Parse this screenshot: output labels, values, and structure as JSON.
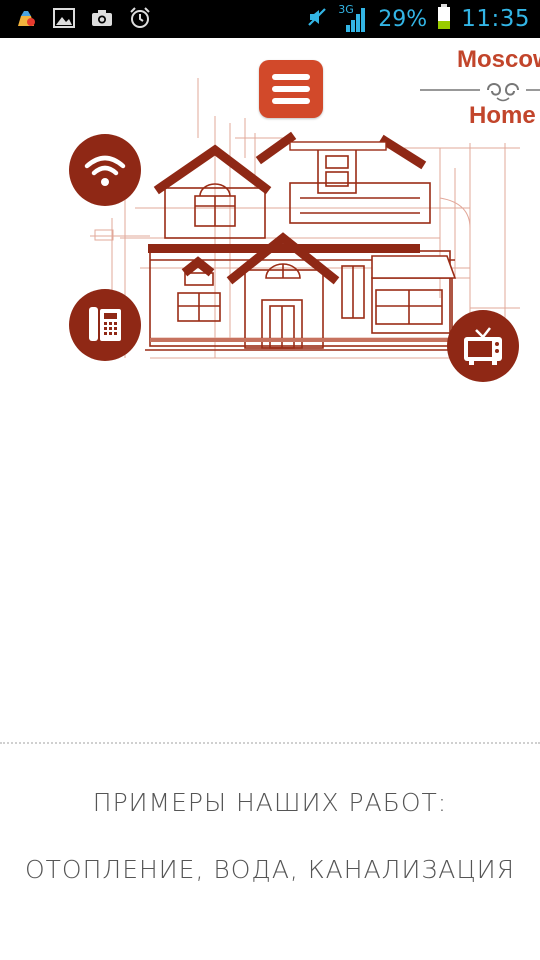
{
  "status_bar": {
    "battery_percent": "29%",
    "time": "11:35",
    "network_label": "3G"
  },
  "header": {
    "brand_line1": "Moscow",
    "brand_line2": "Home"
  },
  "hero": {
    "icons": [
      "wifi-icon",
      "phone-icon",
      "tv-icon"
    ]
  },
  "sections": {
    "examples_heading": "ПРИМЕРЫ НАШИХ РАБОТ:",
    "services_heading": "ОТОПЛЕНИЕ, ВОДА, КАНАЛИЗАЦИЯ"
  },
  "colors": {
    "accent": "#d2492a",
    "dark_accent": "#8f2815",
    "status_blue": "#33b5e5"
  }
}
